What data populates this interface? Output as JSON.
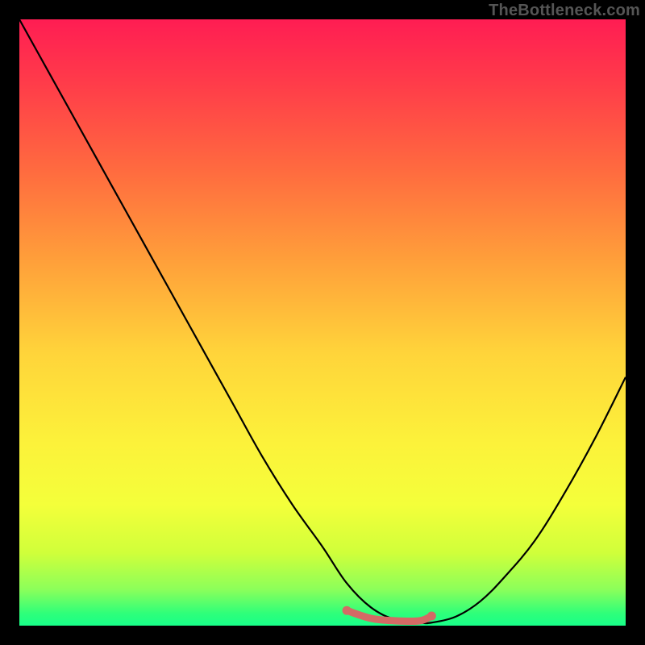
{
  "watermark": "TheBottleneck.com",
  "chart_data": {
    "type": "line",
    "title": "",
    "xlabel": "",
    "ylabel": "",
    "xlim": [
      0,
      100
    ],
    "ylim": [
      0,
      100
    ],
    "grid": false,
    "series": [
      {
        "name": "curve",
        "x": [
          0,
          5,
          10,
          15,
          20,
          25,
          30,
          35,
          40,
          45,
          50,
          54,
          58,
          62,
          66,
          68,
          72,
          76,
          80,
          85,
          90,
          95,
          100
        ],
        "y": [
          100,
          91,
          82,
          73,
          64,
          55,
          46,
          37,
          28,
          20,
          13,
          7,
          3,
          1,
          0.5,
          0.5,
          1.5,
          4,
          8,
          14,
          22,
          31,
          41
        ]
      },
      {
        "name": "optimal-range-marker",
        "x": [
          54,
          58,
          62,
          66,
          68
        ],
        "y": [
          2.5,
          1.2,
          0.8,
          0.8,
          1.6
        ]
      }
    ],
    "annotations": []
  }
}
